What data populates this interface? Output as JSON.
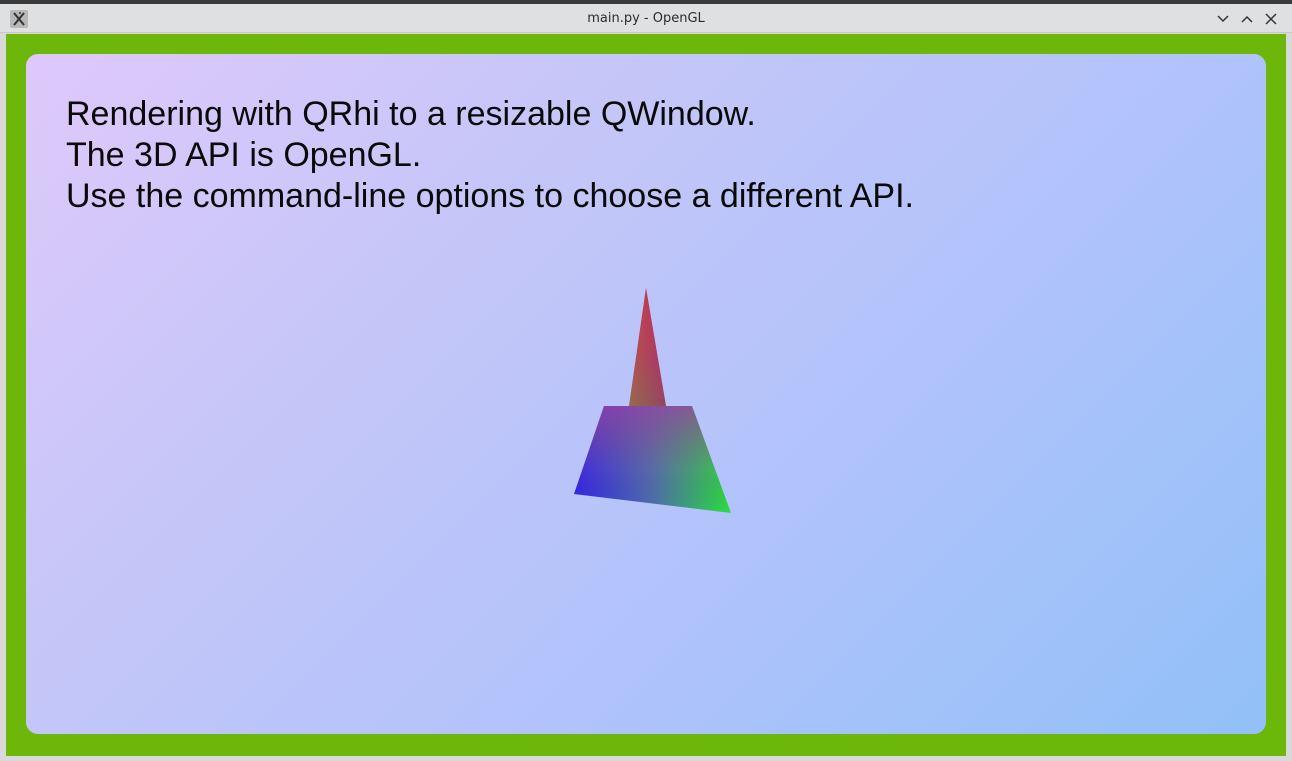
{
  "window": {
    "title": "main.py - OpenGL",
    "app_icon": "x-icon",
    "controls": [
      "chevron-down-icon",
      "chevron-up-icon",
      "close-icon"
    ]
  },
  "content": {
    "lines": [
      "Rendering with QRhi to a resizable QWindow.",
      "The 3D API is OpenGL.",
      "Use the command-line options to choose a different API."
    ]
  },
  "colors": {
    "frame_green": "#6db70a",
    "background_gradient_start": "#dfc8fb",
    "background_gradient_end": "#92c0f8",
    "shape_red": "#e8264a",
    "shape_blue": "#2c2cf0",
    "shape_green": "#28e83c"
  }
}
